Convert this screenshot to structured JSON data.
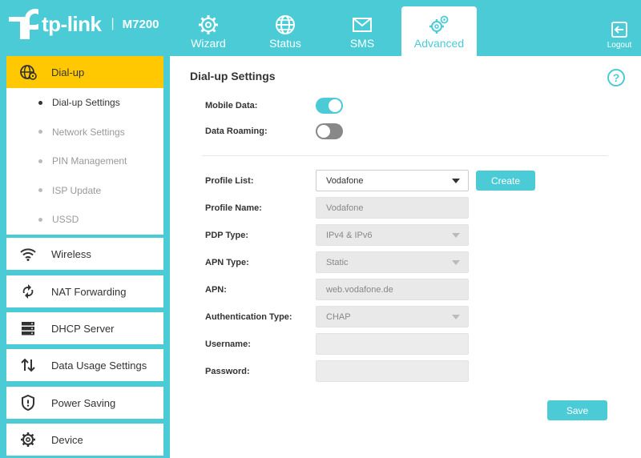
{
  "brand": {
    "name": "tp-link",
    "separator": "|",
    "model": "M7200"
  },
  "nav": {
    "tabs": [
      {
        "label": "Wizard",
        "icon": "gear-icon"
      },
      {
        "label": "Status",
        "icon": "globe-icon"
      },
      {
        "label": "SMS",
        "icon": "envelope-icon"
      },
      {
        "label": "Advanced",
        "icon": "gears-icon",
        "active": true
      }
    ],
    "logout_label": "Logout"
  },
  "sidebar": {
    "sections": [
      {
        "label": "Dial-up",
        "icon": "globe-settings-icon",
        "active": true
      },
      {
        "label": "Wireless",
        "icon": "wifi-icon"
      },
      {
        "label": "NAT Forwarding",
        "icon": "nat-icon"
      },
      {
        "label": "DHCP Server",
        "icon": "server-icon"
      },
      {
        "label": "Data Usage Settings",
        "icon": "updown-arrows-icon"
      },
      {
        "label": "Power Saving",
        "icon": "shield-icon"
      },
      {
        "label": "Device",
        "icon": "gear-icon"
      }
    ],
    "dialup_items": [
      {
        "label": "Dial-up Settings",
        "current": true
      },
      {
        "label": "Network Settings"
      },
      {
        "label": "PIN Management"
      },
      {
        "label": "ISP Update"
      },
      {
        "label": "USSD"
      }
    ]
  },
  "content": {
    "title": "Dial-up Settings",
    "help": "?",
    "mobile_data": {
      "label": "Mobile Data:",
      "on": true
    },
    "data_roaming": {
      "label": "Data Roaming:",
      "on": false
    },
    "profile_list": {
      "label": "Profile List:",
      "value": "Vodafone"
    },
    "create_label": "Create",
    "profile_name": {
      "label": "Profile Name:",
      "value": "Vodafone"
    },
    "pdp_type": {
      "label": "PDP Type:",
      "value": "IPv4 & IPv6"
    },
    "apn_type": {
      "label": "APN Type:",
      "value": "Static"
    },
    "apn": {
      "label": "APN:",
      "value": "web.vodafone.de"
    },
    "auth_type": {
      "label": "Authentication Type:",
      "value": "CHAP"
    },
    "username": {
      "label": "Username:",
      "value": ""
    },
    "password": {
      "label": "Password:",
      "value": ""
    },
    "save_label": "Save"
  },
  "colors": {
    "accent": "#4acbd6",
    "active_menu": "#ffc800"
  }
}
